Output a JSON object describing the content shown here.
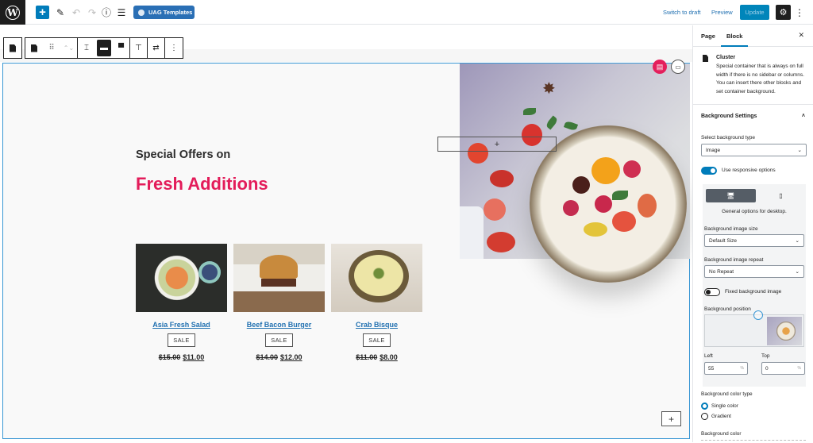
{
  "topbar": {
    "logo": "W",
    "add_label": "+",
    "edit_icon": "✎",
    "undo_icon": "↶",
    "redo_icon": "↷",
    "info_icon": "ⓘ",
    "list_icon": "☰",
    "uag_templates": "UAG Templates",
    "switch_to_draft": "Switch to draft",
    "preview": "Preview",
    "update": "Update",
    "settings_icon": "⚙",
    "more_icon": "⋮"
  },
  "block_toolbar": {
    "parent_icon": "block-icon",
    "drag_icon": "⠿",
    "move_icon": "⌃⌄",
    "align_icons": [
      "⌶",
      "▬",
      "▀"
    ],
    "valign_icon": "⊤",
    "transform_icon": "⇄",
    "more_icon": "⋮"
  },
  "hero": {
    "subtitle": "Special Offers on",
    "title": "Fresh Additions",
    "title_color": "#e31c5a",
    "placeholder_add": "+",
    "bottom_add": "+"
  },
  "products": [
    {
      "name": "Asia Fresh Salad",
      "badge": "SALE",
      "old_price": "$15.00",
      "new_price": "$11.00"
    },
    {
      "name": "Beef Bacon Burger",
      "badge": "SALE",
      "old_price": "$14.00",
      "new_price": "$12.00"
    },
    {
      "name": "Crab Bisque",
      "badge": "SALE",
      "old_price": "$11.00",
      "new_price": "$8.00"
    }
  ],
  "sidebar": {
    "tabs": [
      "Page",
      "Block"
    ],
    "active_tab": "Block",
    "close_icon": "✕",
    "block_name": "Cluster",
    "block_description": "Special container that is always on full width if there is no sidebar or columns. You can insert there other blocks and set container background.",
    "panel_title": "Background Settings",
    "panel_chevron": "˄",
    "bg_type_label": "Select background type",
    "bg_type_value": "Image",
    "responsive_label": "Use responsive options",
    "responsive_on": true,
    "device_desktop_icon": "🖥",
    "device_mobile_icon": "▯",
    "device_note": "General options for desktop.",
    "img_size_label": "Background image size",
    "img_size_value": "Default Size",
    "img_repeat_label": "Background image repeat",
    "img_repeat_value": "No Repeat",
    "fixed_label": "Fixed background image",
    "fixed_on": false,
    "position_label": "Background position",
    "left_label": "Left",
    "left_value": "55",
    "top_label": "Top",
    "top_value": "0",
    "unit": "%",
    "color_type_label": "Background color type",
    "color_type_options": [
      "Single color",
      "Gradient"
    ],
    "color_type_selected": "Single color",
    "bg_color_label": "Background color"
  },
  "colors": {
    "accent": "#007cba",
    "brand_red": "#e41f5c",
    "link": "#2271b1",
    "selection_border": "#3a97d4"
  }
}
